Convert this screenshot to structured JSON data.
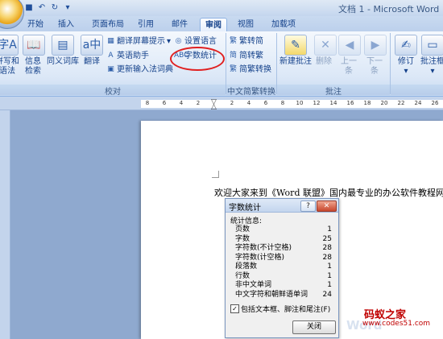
{
  "window": {
    "title": "文档 1 - Microsoft Word"
  },
  "qat": {
    "icons": [
      "save-icon",
      "undo-icon",
      "redo-icon"
    ],
    "undo": "↶",
    "redo": "↻",
    "save": "■",
    "more": "▾"
  },
  "tabs": [
    "开始",
    "插入",
    "页面布局",
    "引用",
    "邮件",
    "审阅",
    "视图",
    "加载项"
  ],
  "active_tab": "审阅",
  "ribbon": {
    "proofing": {
      "label": "校对",
      "spelling_line1": "拼写和",
      "spelling_line2": "语法",
      "research_line1": "信息",
      "research_line2": "检索",
      "thesaurus": "同义词库",
      "translate": "翻译",
      "translate_screentip": "翻译屏幕提示",
      "english_assistant": "英语助手",
      "update_ime": "更新输入法词典",
      "set_language": "设置语言",
      "word_count": "字数统计"
    },
    "chinese_conversion": {
      "label": "中文简繁转换",
      "to_traditional": "繁转简",
      "to_simplified": "简转繁",
      "conversion": "简繁转换"
    },
    "comments": {
      "label": "批注",
      "new_comment": "新建批注",
      "delete": "删除",
      "previous_line1": "上一",
      "previous_line2": "条",
      "next_line1": "下一",
      "next_line2": "条"
    },
    "tracking": {
      "track": "修订",
      "balloons": "批注框"
    }
  },
  "ruler": {
    "numbers": [
      "8",
      "6",
      "4",
      "2",
      "2",
      "4",
      "6",
      "8",
      "10",
      "12",
      "14",
      "16",
      "18",
      "20",
      "22",
      "24",
      "26"
    ]
  },
  "document": {
    "text": "欢迎大家来到《Word 联盟》国内最专业的办公软件教程网!"
  },
  "dialog": {
    "title": "字数统计",
    "help": "?",
    "close_x": "✕",
    "section": "统计信息:",
    "stats": [
      {
        "label": "页数",
        "value": "1"
      },
      {
        "label": "字数",
        "value": "25"
      },
      {
        "label": "字符数(不计空格)",
        "value": "28"
      },
      {
        "label": "字符数(计空格)",
        "value": "28"
      },
      {
        "label": "段落数",
        "value": "1"
      },
      {
        "label": "行数",
        "value": "1"
      },
      {
        "label": "非中文单词",
        "value": "1"
      },
      {
        "label": "中文字符和朝鲜语单词",
        "value": "24"
      }
    ],
    "checkbox_checked": true,
    "checkbox_label": "包括文本框、脚注和尾注(F)",
    "close_button": "关闭"
  },
  "watermark": {
    "line1": "码蚁之家",
    "line2": "www.codes51.com",
    "bg": "Word"
  }
}
